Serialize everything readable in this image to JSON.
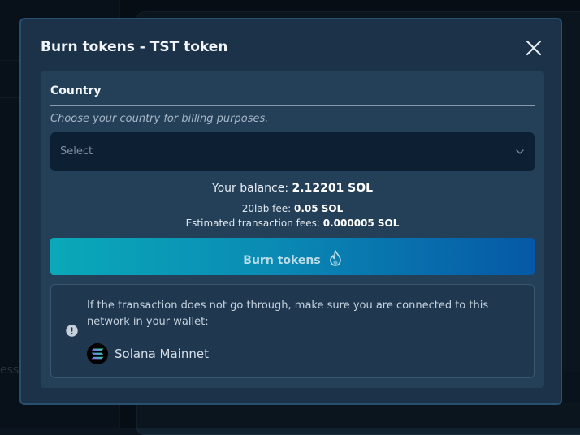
{
  "background": {
    "ghost_text": "ess"
  },
  "modal": {
    "title": "Burn tokens - TST token",
    "close_icon": "close-icon"
  },
  "country_field": {
    "label": "Country",
    "help_text": "Choose your country for billing purposes.",
    "select_value": "Select"
  },
  "balance": {
    "label": "Your balance:",
    "value": "2.12201 SOL"
  },
  "fees": {
    "service_label": "20lab fee:",
    "service_value": "0.05 SOL",
    "tx_label": "Estimated transaction fees:",
    "tx_value": "0.000005 SOL"
  },
  "burn_button": {
    "label": "Burn tokens",
    "icon": "flame-icon"
  },
  "info_box": {
    "text": "If the transaction does not go through, make sure you are connected to this network in your wallet:",
    "icon": "alert-circle-icon",
    "network_name": "Solana Mainnet",
    "network_icon": "solana-logo-icon"
  },
  "colors": {
    "modal_bg": "#1c3249",
    "panel_bg": "#244059",
    "select_bg": "#0d1f33",
    "button_gradient_start": "#0aa9b9",
    "button_gradient_end": "#0658a6"
  }
}
